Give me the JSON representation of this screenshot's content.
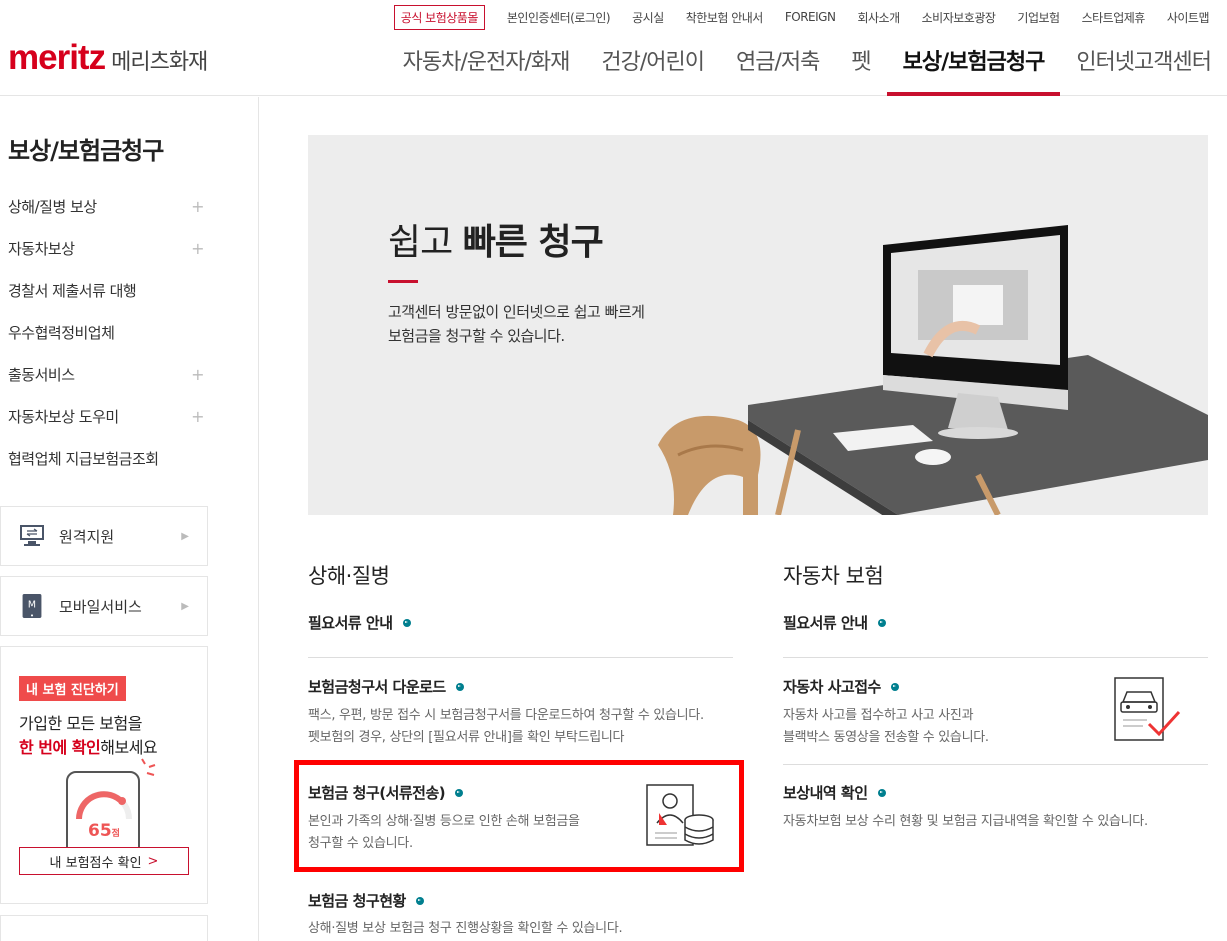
{
  "header": {
    "util_links": [
      "공식 보험상품몰",
      "본인인증센터(로그인)",
      "공시실",
      "착한보험 안내서",
      "FOREIGN",
      "회사소개",
      "소비자보호광장",
      "기업보험",
      "스타트업제휴",
      "사이트맵"
    ],
    "logo_en": "meritz",
    "logo_ko": "메리츠화재",
    "gnb": [
      "자동차/운전자/화재",
      "건강/어린이",
      "연금/저축",
      "펫",
      "보상/보험금청구",
      "인터넷고객센터"
    ]
  },
  "sidebar": {
    "title": "보상/보험금청구",
    "items": [
      {
        "label": "상해/질병 보상",
        "expandable": true
      },
      {
        "label": "자동차보상",
        "expandable": true
      },
      {
        "label": "경찰서 제출서류 대행",
        "expandable": false
      },
      {
        "label": "우수협력정비업체",
        "expandable": false
      },
      {
        "label": "출동서비스",
        "expandable": true
      },
      {
        "label": "자동차보상 도우미",
        "expandable": true
      },
      {
        "label": "협력업체 지급보험금조회",
        "expandable": false
      }
    ],
    "plus": "+",
    "remote": "원격지원",
    "mobile": "모바일서비스",
    "mobile_icon_letter": "M",
    "diag": {
      "tag": "내 보험 진단하기",
      "line1": "가입한 모든 보험을",
      "line2_red": "한 번에 확인",
      "line2_rest": "해보세요",
      "score": "65",
      "score_unit": "점",
      "button": "내 보험점수 확인",
      "chevron": ">"
    }
  },
  "banner": {
    "title_light": "쉽고 ",
    "title_bold": "빠른 청구",
    "desc1": "고객센터 방문없이 인터넷으로 쉽고 빠르게",
    "desc2": "보험금을 청구할 수 있습니다."
  },
  "left_col": {
    "title": "상해·질병",
    "docs": "필요서류 안내",
    "download_title": "보험금청구서 다운로드",
    "download_desc1": "팩스, 우편, 방문 접수 시 보험금청구서를 다운로드하여 청구할 수 있습니다.",
    "download_desc2": "펫보험의 경우, 상단의 [필요서류 안내]를 확인 부탁드립니다",
    "claim_title": "보험금 청구(서류전송)",
    "claim_desc1": "본인과 가족의 상해·질병 등으로 인한 손해 보험금을",
    "claim_desc2": "청구할 수 있습니다.",
    "status_title": "보험금 청구현황",
    "status_desc": "상해·질병 보상 보험금 청구 진행상황을 확인할 수 있습니다."
  },
  "right_col": {
    "title": "자동차 보험",
    "docs": "필요서류 안내",
    "accident_title": "자동차 사고접수",
    "accident_desc1": "자동차 사고를 접수하고 사고 사진과",
    "accident_desc2": "블랙박스 동영상을 전송할 수 있습니다.",
    "history_title": "보상내역 확인",
    "history_desc": "자동차보험 보상 수리 현황 및 보험금 지급내역을 확인할 수 있습니다."
  },
  "colors": {
    "brand": "#d6001c",
    "accent_dot": "#007f8f",
    "highlight": "#ff0000"
  }
}
